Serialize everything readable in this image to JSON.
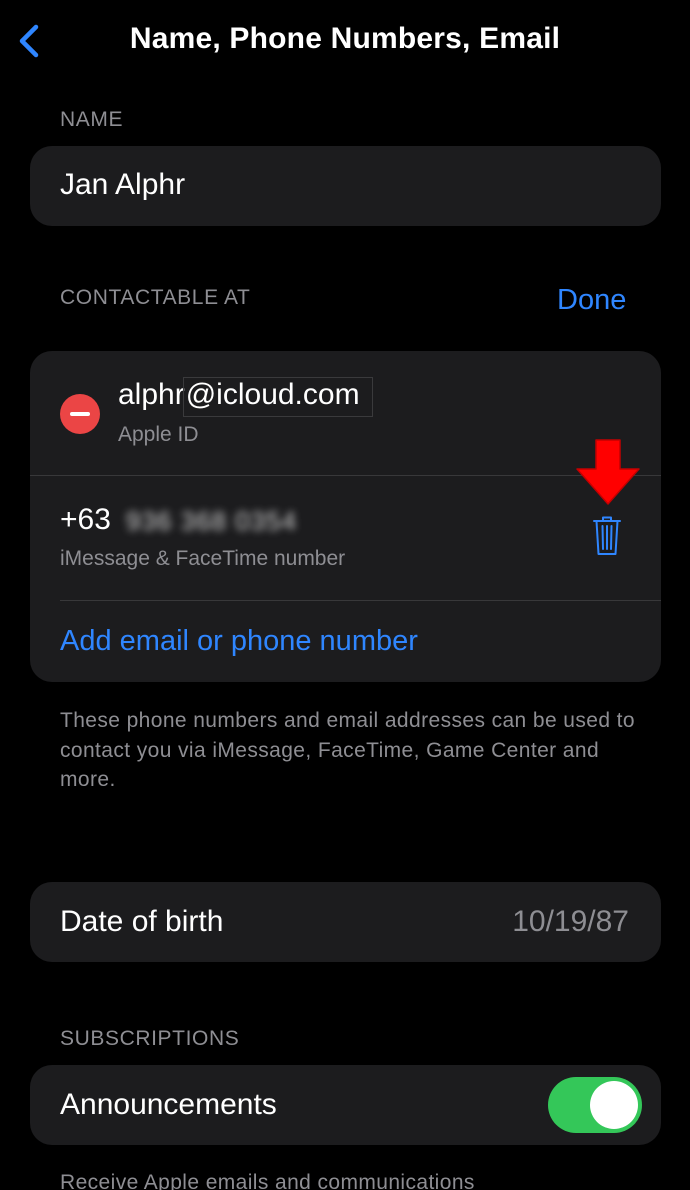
{
  "header": {
    "title": "Name, Phone Numbers, Email",
    "back_icon": "chevron-left-icon"
  },
  "name_section": {
    "label": "NAME",
    "value": "Jan Alphr"
  },
  "contact_section": {
    "label": "CONTACTABLE AT",
    "done_label": "Done",
    "email": {
      "user": "alphr",
      "domain": "@icloud.com",
      "subtitle": "Apple ID"
    },
    "phone": {
      "prefix": "+63",
      "number_blurred": "936 368 0354",
      "subtitle": "iMessage & FaceTime number"
    },
    "add_label": "Add email or phone number",
    "footnote": "These phone numbers and email addresses can be used to contact you via iMessage, FaceTime, Game Center and more."
  },
  "dob": {
    "label": "Date of birth",
    "value": "10/19/87"
  },
  "subscriptions": {
    "label": "SUBSCRIPTIONS",
    "item_label": "Announcements",
    "toggle_on": true,
    "footnote": "Receive Apple emails and communications"
  },
  "colors": {
    "accent": "#2f86ff",
    "remove": "#eb4545",
    "toggle_on": "#34c759",
    "annotation_arrow": "#ff0000",
    "card_bg": "#1c1c1e",
    "secondary_text": "#8e8e93"
  }
}
